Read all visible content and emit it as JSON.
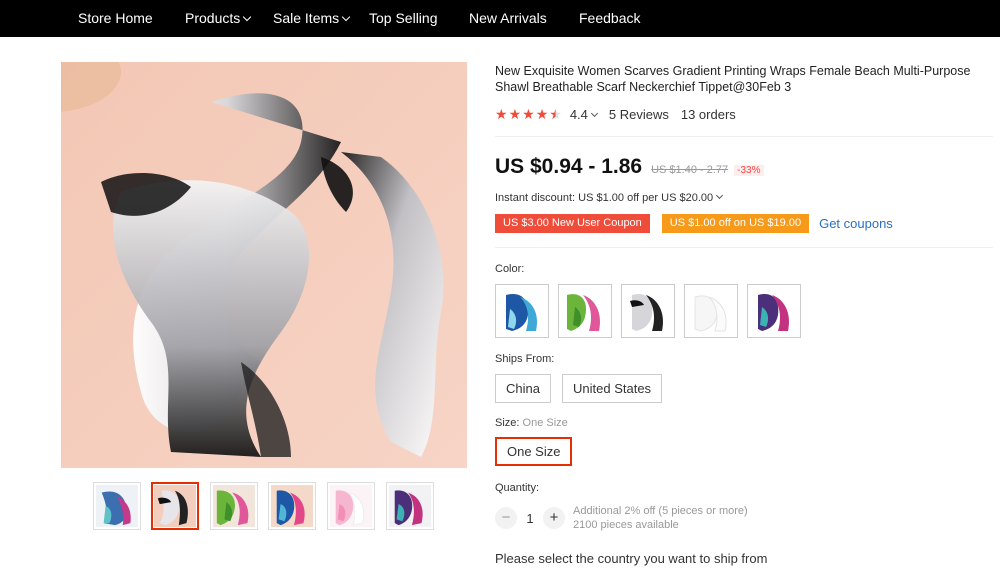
{
  "nav": {
    "store_home": "Store Home",
    "products": "Products",
    "sale_items": "Sale Items",
    "top_selling": "Top Selling",
    "new_arrivals": "New Arrivals",
    "feedback": "Feedback"
  },
  "product": {
    "title": "New Exquisite Women Scarves Gradient Printing Wraps Female Beach Multi-Purpose Shawl Breathable Scarf Neckerchief Tippet@30Feb 3",
    "rating": "4.4",
    "rating_stars": 4.5,
    "reviews": "5 Reviews",
    "orders": "13 orders",
    "price": "US $0.94 - 1.86",
    "original_price": "US $1.40 - 2.77",
    "discount": "-33%",
    "instant_discount": "Instant discount: US $1.00 off per US $20.00"
  },
  "coupons": {
    "new_user": "US $3.00 New User Coupon",
    "store": "US $1.00 off on US $19.00",
    "get_coupons": "Get coupons"
  },
  "options": {
    "color_label": "Color:",
    "ships_from_label": "Ships From:",
    "ships_from": [
      "China",
      "United States"
    ],
    "size_label": "Size:",
    "size_value": "One Size",
    "size_option": "One Size",
    "quantity_label": "Quantity:",
    "quantity": "1",
    "qty_minus": "−",
    "qty_plus": "+",
    "additional_off": "Additional 2% off (5 pieces or more)",
    "available": "2100 pieces available"
  },
  "ship_note": "Please select the country you want to ship from",
  "icons": {
    "star": "star-icon",
    "half_star": "half-star-icon",
    "chevron": "chevron-down-icon"
  },
  "colors": {
    "nav_bg": "#000000",
    "accent_red": "#e62e04",
    "star_red": "#f04c3a",
    "coupon_orange": "#f79a1a",
    "link_blue": "#2a6fc4"
  }
}
